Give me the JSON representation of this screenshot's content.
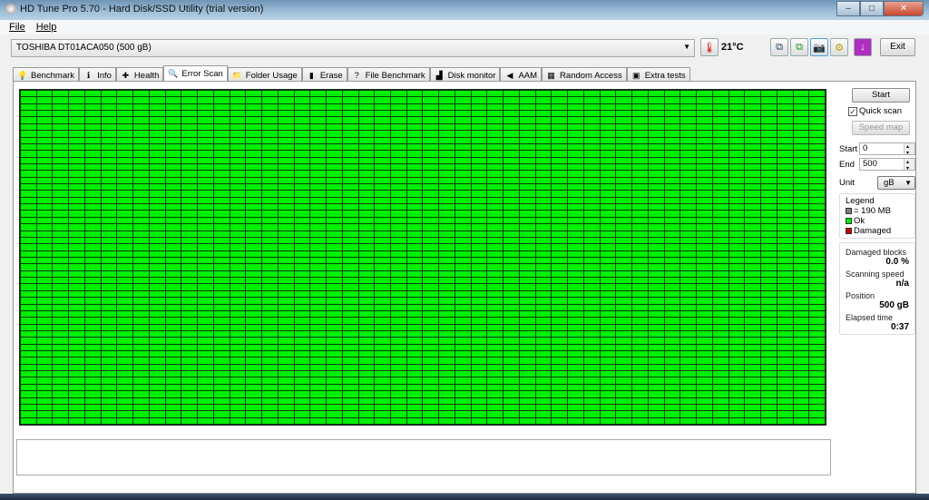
{
  "window": {
    "title": "HD Tune Pro 5.70 - Hard Disk/SSD Utility (trial version)"
  },
  "menu": [
    "File",
    "Help"
  ],
  "toolbar": {
    "drive": "TOSHIBA DT01ACA050 (500 gB)",
    "temperature": "21°C",
    "exit_label": "Exit"
  },
  "tabs": [
    {
      "label": "Benchmark",
      "icon": "💡"
    },
    {
      "label": "Info",
      "icon": "ℹ"
    },
    {
      "label": "Health",
      "icon": "✚"
    },
    {
      "label": "Error Scan",
      "icon": "🔍"
    },
    {
      "label": "Folder Usage",
      "icon": "📁"
    },
    {
      "label": "Erase",
      "icon": "▮"
    },
    {
      "label": "File Benchmark",
      "icon": "?"
    },
    {
      "label": "Disk monitor",
      "icon": "▟"
    },
    {
      "label": "AAM",
      "icon": "◀"
    },
    {
      "label": "Random Access",
      "icon": "▦"
    },
    {
      "label": "Extra tests",
      "icon": "▣"
    }
  ],
  "active_tab": "Error Scan",
  "side": {
    "start_button": "Start",
    "quick_scan_label": "Quick scan",
    "quick_scan_checked": true,
    "speed_map_button": "Speed map",
    "start_label": "Start",
    "start_value": "0",
    "end_label": "End",
    "end_value": "500",
    "unit_label": "Unit",
    "unit_value": "gB",
    "legend_title": "Legend",
    "legend_block": "= 190 MB",
    "legend_ok": "Ok",
    "legend_damaged": "Damaged",
    "damaged_blocks_label": "Damaged blocks",
    "damaged_blocks_value": "0.0 %",
    "scanning_speed_label": "Scanning speed",
    "scanning_speed_value": "n/a",
    "position_label": "Position",
    "position_value": "500 gB",
    "elapsed_label": "Elapsed time",
    "elapsed_value": "0:37"
  },
  "colors": {
    "ok": "#00f000",
    "damaged": "#cc0000",
    "block": "#808080"
  }
}
